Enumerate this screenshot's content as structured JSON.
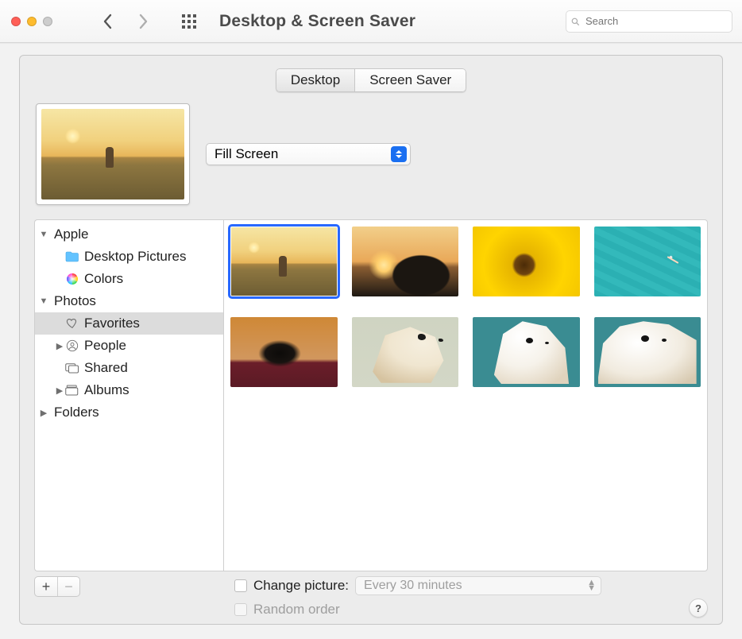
{
  "window": {
    "title": "Desktop & Screen Saver",
    "search_placeholder": "Search"
  },
  "tabs": {
    "desktop": "Desktop",
    "screensaver": "Screen Saver",
    "active": "desktop"
  },
  "fill_mode": {
    "selected": "Fill Screen"
  },
  "sidebar": [
    {
      "label": "Apple",
      "level": 0,
      "expanded": true,
      "has_children": true,
      "icon": "",
      "selected": false
    },
    {
      "label": "Desktop Pictures",
      "level": 1,
      "expanded": null,
      "has_children": false,
      "icon": "folder",
      "selected": false
    },
    {
      "label": "Colors",
      "level": 1,
      "expanded": null,
      "has_children": false,
      "icon": "colorwheel",
      "selected": false
    },
    {
      "label": "Photos",
      "level": 0,
      "expanded": true,
      "has_children": true,
      "icon": "",
      "selected": false
    },
    {
      "label": "Favorites",
      "level": 1,
      "expanded": null,
      "has_children": false,
      "icon": "heart",
      "selected": true
    },
    {
      "label": "People",
      "level": 1,
      "expanded": false,
      "has_children": true,
      "icon": "person",
      "selected": false
    },
    {
      "label": "Shared",
      "level": 1,
      "expanded": null,
      "has_children": false,
      "icon": "shared",
      "selected": false
    },
    {
      "label": "Albums",
      "level": 1,
      "expanded": false,
      "has_children": true,
      "icon": "albums",
      "selected": false
    },
    {
      "label": "Folders",
      "level": 0,
      "expanded": false,
      "has_children": true,
      "icon": "",
      "selected": false
    }
  ],
  "thumbnails": [
    {
      "img": "sunset",
      "selected": true
    },
    {
      "img": "rock",
      "selected": false
    },
    {
      "img": "sunflower",
      "selected": false
    },
    {
      "img": "sea",
      "selected": false
    },
    {
      "img": "dachshund",
      "selected": false
    },
    {
      "img": "afghan-fawn",
      "selected": false
    },
    {
      "img": "afghan-teal-p",
      "selected": false
    },
    {
      "img": "afghan-teal-l",
      "selected": false
    }
  ],
  "footer": {
    "change_picture_label": "Change picture:",
    "change_picture_interval": "Every 30 minutes",
    "change_picture_checked": false,
    "random_order_label": "Random order",
    "random_order_checked": false
  }
}
